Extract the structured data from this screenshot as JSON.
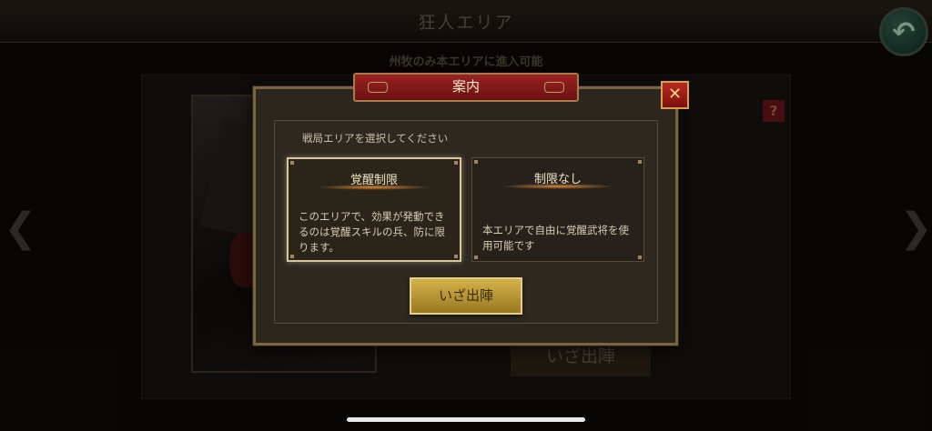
{
  "header": {
    "title": "狂人エリア",
    "back_icon": "back-arrow-icon",
    "back_glyph": "↶"
  },
  "background": {
    "subtitle": "州牧のみ本エリアに進入可能",
    "help_label": "?",
    "sortie_label": "いざ出陣",
    "nav_left_icon": "chevron-left-icon",
    "nav_right_icon": "chevron-right-icon",
    "nav_left_glyph": "❮",
    "nav_right_glyph": "❯"
  },
  "modal": {
    "title": "案内",
    "close_label": "✕",
    "close_icon": "close-icon",
    "instruction": "戦局エリアを選択してください",
    "options": [
      {
        "title": "覚醒制限",
        "description": "このエリアで、効果が発動できるのは覚醒スキルの兵、防に限ります。",
        "selected": true
      },
      {
        "title": "制限なし",
        "description": "本エリアで自由に覚醒武将を使用可能です",
        "selected": false
      }
    ],
    "confirm_label": "いざ出陣"
  },
  "colors": {
    "banner_red": "#9a2322",
    "gold_button": "#d3b14a",
    "frame_bronze": "#7a6441"
  }
}
